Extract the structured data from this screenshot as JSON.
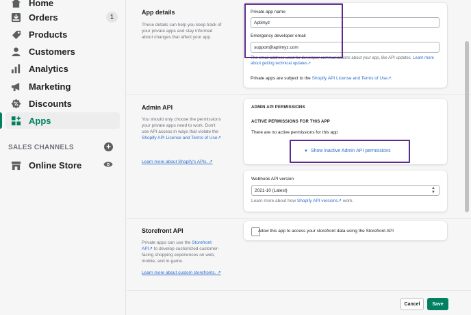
{
  "sidebar": {
    "items": [
      {
        "label": "Home",
        "icon": "home-icon"
      },
      {
        "label": "Orders",
        "icon": "orders-icon",
        "badge": "1"
      },
      {
        "label": "Products",
        "icon": "products-icon"
      },
      {
        "label": "Customers",
        "icon": "customers-icon"
      },
      {
        "label": "Analytics",
        "icon": "analytics-icon"
      },
      {
        "label": "Marketing",
        "icon": "marketing-icon"
      },
      {
        "label": "Discounts",
        "icon": "discounts-icon"
      },
      {
        "label": "Apps",
        "icon": "apps-icon"
      }
    ],
    "sales_channels_heading": "SALES CHANNELS",
    "sales_channels": [
      {
        "label": "Online Store",
        "icon": "store-icon"
      }
    ],
    "accent_color": "#008060"
  },
  "app_details": {
    "title": "App details",
    "description": "These details can help you keep track of your private apps and stay informed about changes that affect your app.",
    "private_app_name_label": "Private app name",
    "private_app_name_value": "Aptimyz",
    "emergency_email_label": "Emergency developer email",
    "emergency_email_value": "support@aptimyz.com",
    "email_help_prefix": "The email address used for developer communications about your app, like API updates.",
    "email_help_link": "Learn more about getting technical updates",
    "terms_prefix": "Private apps are subject to the",
    "terms_link": "Shopify API License and Terms of Use",
    "terms_suffix": "."
  },
  "admin_api": {
    "title": "Admin API",
    "description_1": "You should only choose the permissions your private apps need to work. Don't use API access in ways that violate the",
    "description_link": "Shopify API License and Terms of Use",
    "description_end": ".",
    "learn_more": "Learn more about Shopify's APIs.",
    "permissions_heading": "ADMIN API PERMISSIONS",
    "active_heading": "ACTIVE PERMISSIONS FOR THIS APP",
    "no_permissions": "There are no active permissions for this app",
    "show_inactive": "Show inactive Admin API permissions",
    "webhook_label": "Webhook API version",
    "webhook_value": "2021-10 (Latest)",
    "webhook_help_prefix": "Learn more about how",
    "webhook_help_link": "Shopify API versions",
    "webhook_help_suffix": "work."
  },
  "storefront_api": {
    "title": "Storefront API",
    "desc_prefix": "Private apps can use the",
    "desc_link": "Storefront API",
    "desc_suffix": "to develop customized customer-facing shopping experiences on web, mobile, and in-game.",
    "learn_more": "Learn more about custom storefronts.",
    "checkbox_label": "Allow this app to access your storefront data using the Storefront API"
  },
  "footer": {
    "cancel_label": "Cancel",
    "save_label": "Save"
  },
  "highlight_color": "#5b2a8c"
}
